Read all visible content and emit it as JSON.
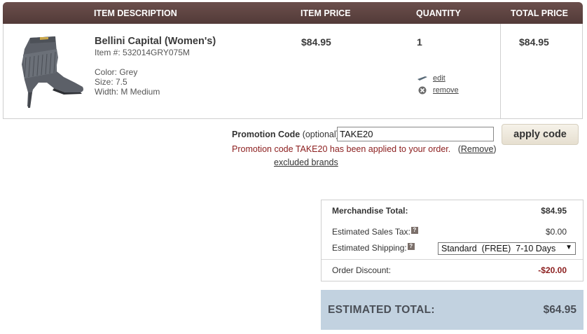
{
  "header": {
    "item_description": "ITEM DESCRIPTION",
    "item_price": "ITEM PRICE",
    "quantity": "QUANTITY",
    "total_price": "TOTAL PRICE"
  },
  "item": {
    "name": "Bellini Capital (Women's)",
    "item_number": "Item #: 532014GRY075M",
    "color": "Color: Grey",
    "size": "Size: 7.5",
    "width": "Width: M Medium",
    "price": "$84.95",
    "quantity": "1",
    "total": "$84.95",
    "edit_label": "edit",
    "remove_label": "remove",
    "image_icon": "boot-image"
  },
  "promo": {
    "label_bold": "Promotion Code",
    "label_optional": " (optional):",
    "code_value": "TAKE20",
    "apply_label": "apply code",
    "message": "Promotion code TAKE20 has been applied to your order.",
    "remove_paren_open": "(",
    "remove_label": "Remove",
    "remove_paren_close": ")",
    "excluded_brands_label": "excluded brands"
  },
  "summary": {
    "merchandise_label": "Merchandise Total:",
    "merchandise_value": "$84.95",
    "tax_label": "Estimated Sales Tax:",
    "tax_value": "$0.00",
    "shipping_label": "Estimated Shipping:",
    "shipping_selected": "Standard  (FREE)  7-10 Days",
    "discount_label": "Order Discount:",
    "discount_value": "-$20.00",
    "help_icon_glyph": "?",
    "dropdown_arrow": "▼"
  },
  "estimated_total": {
    "label": "ESTIMATED TOTAL:",
    "value": "$64.95"
  },
  "colors": {
    "header_bg": "#5e4543",
    "discount": "#8b1d1d",
    "promo_message": "#8b1d1d",
    "total_bg": "#c2d2e0"
  }
}
